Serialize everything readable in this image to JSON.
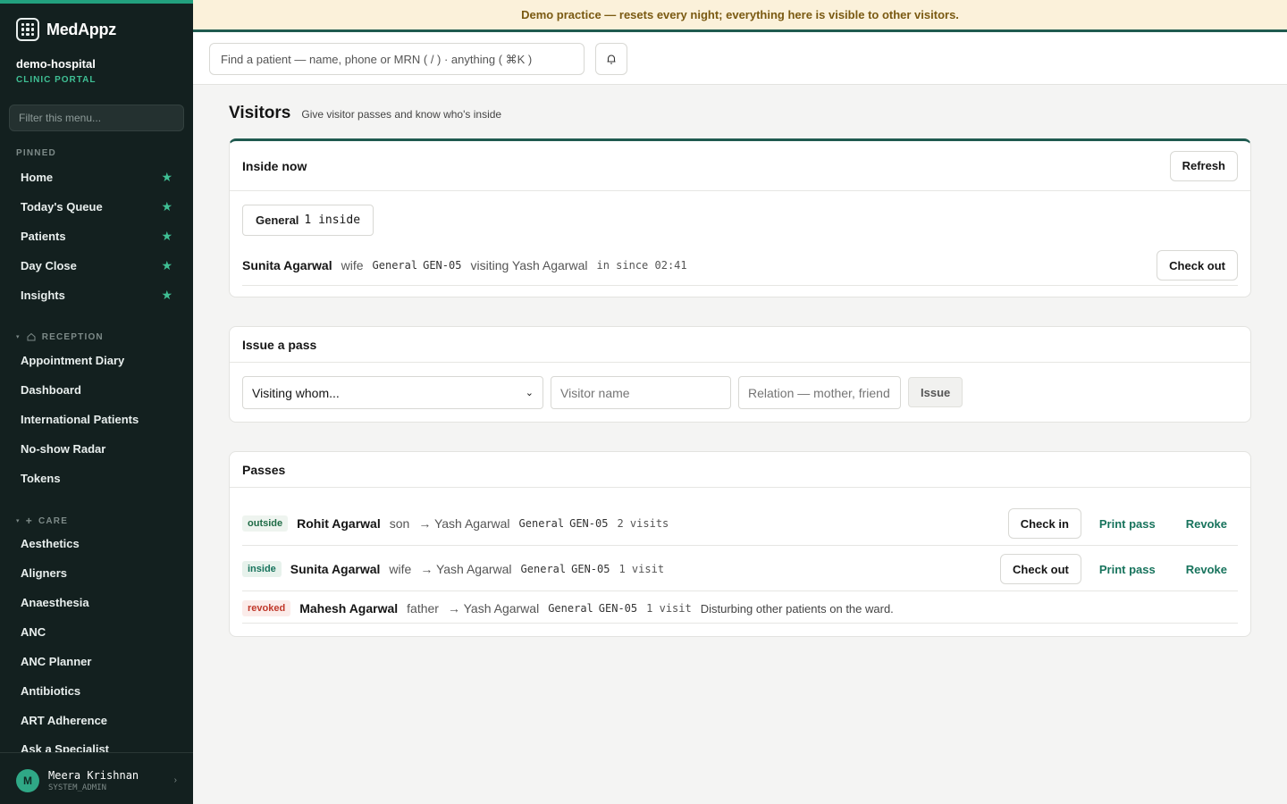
{
  "brand": {
    "name": "MedAppz"
  },
  "tenant": {
    "name": "demo-hospital",
    "subtitle": "CLINIC PORTAL"
  },
  "sidebar": {
    "filter_placeholder": "Filter this menu...",
    "pinned_label": "PINNED",
    "pinned": [
      {
        "label": "Home"
      },
      {
        "label": "Today's Queue"
      },
      {
        "label": "Patients"
      },
      {
        "label": "Day Close"
      },
      {
        "label": "Insights"
      }
    ],
    "reception_label": "RECEPTION",
    "reception": [
      {
        "label": "Appointment Diary"
      },
      {
        "label": "Dashboard"
      },
      {
        "label": "International Patients"
      },
      {
        "label": "No-show Radar"
      },
      {
        "label": "Tokens"
      }
    ],
    "care_label": "CARE",
    "care": [
      {
        "label": "Aesthetics"
      },
      {
        "label": "Aligners"
      },
      {
        "label": "Anaesthesia"
      },
      {
        "label": "ANC"
      },
      {
        "label": "ANC Planner"
      },
      {
        "label": "Antibiotics"
      },
      {
        "label": "ART Adherence"
      },
      {
        "label": "Ask a Specialist"
      }
    ]
  },
  "user": {
    "initial": "M",
    "name": "Meera Krishnan",
    "role": "SYSTEM_ADMIN"
  },
  "banner": {
    "text": "Demo practice — resets every night; everything here is visible to other visitors."
  },
  "search": {
    "placeholder": "Find a patient — name, phone or MRN ( / ) · anything ( ⌘K )"
  },
  "page": {
    "title": "Visitors",
    "subtitle": "Give visitor passes and know who's inside"
  },
  "inside_now": {
    "title": "Inside now",
    "refresh_label": "Refresh",
    "ward_chip": {
      "ward": "General",
      "count": "1 inside"
    },
    "entry": {
      "name": "Sunita Agarwal",
      "relation": "wife",
      "ward": "General",
      "bed": "GEN-05",
      "visiting": "visiting Yash Agarwal",
      "since": "in since 02:41",
      "action": "Check out"
    }
  },
  "issue": {
    "title": "Issue a pass",
    "visiting_placeholder": "Visiting whom...",
    "visitor_placeholder": "Visitor name",
    "relation_placeholder": "Relation — mother, friend",
    "issue_label": "Issue"
  },
  "passes": {
    "title": "Passes",
    "rows": [
      {
        "status": "outside",
        "name": "Rohit Agarwal",
        "relation": "son",
        "patient": "→ Yash Agarwal",
        "ward": "General",
        "bed": "GEN-05",
        "visits": "2 visits",
        "primary": "Check in",
        "print": "Print pass",
        "revoke": "Revoke"
      },
      {
        "status": "inside",
        "name": "Sunita Agarwal",
        "relation": "wife",
        "patient": "→ Yash Agarwal",
        "ward": "General",
        "bed": "GEN-05",
        "visits": "1 visit",
        "primary": "Check out",
        "print": "Print pass",
        "revoke": "Revoke"
      },
      {
        "status": "revoked",
        "name": "Mahesh Agarwal",
        "relation": "father",
        "patient": "→ Yash Agarwal",
        "ward": "General",
        "bed": "GEN-05",
        "visits": "1 visit",
        "reason": "Disturbing other patients on the ward."
      }
    ]
  },
  "colors": {
    "sidebar_bg": "#13201f",
    "accent": "#22a07e",
    "banner_bg": "#fbf1da",
    "link": "#17735c",
    "revoked": "#c0392b"
  }
}
